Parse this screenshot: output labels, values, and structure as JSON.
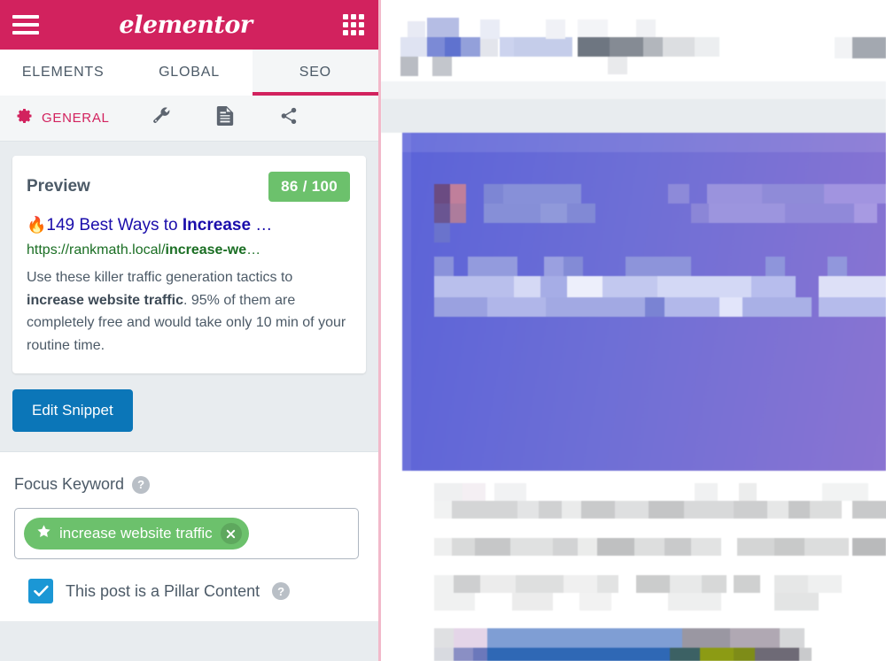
{
  "brand": {
    "name": "elementor",
    "menu_icon": "hamburger-icon",
    "apps_icon": "grid-icon"
  },
  "tabs": [
    {
      "label": "ELEMENTS",
      "active": false
    },
    {
      "label": "GLOBAL",
      "active": false
    },
    {
      "label": "SEO",
      "active": true
    }
  ],
  "subtabs": [
    {
      "label": "GENERAL",
      "icon": "gear-icon",
      "active": true
    },
    {
      "label": "",
      "icon": "wrench-icon",
      "active": false
    },
    {
      "label": "",
      "icon": "document-icon",
      "active": false
    },
    {
      "label": "",
      "icon": "share-icon",
      "active": false
    }
  ],
  "preview": {
    "heading": "Preview",
    "score": "86 / 100",
    "score_color": "#6cc16c",
    "snippet": {
      "emoji": "🔥",
      "title_plain": "149 Best Ways to ",
      "title_bold": "Increase",
      "title_ellipsis": " …",
      "url_base": "https://rankmath.local/",
      "url_slug": "increase-we",
      "url_ellipsis": "…",
      "desc_part1": "Use these killer traffic generation tactics to ",
      "desc_bold": "increase website traffic",
      "desc_part2": ". 95% of them are completely free and would take only 10 min of your routine time."
    }
  },
  "actions": {
    "edit_snippet": "Edit Snippet",
    "edit_snippet_color": "#0b76b8"
  },
  "focus_keyword": {
    "label": "Focus Keyword",
    "help": "?",
    "tag": "increase website traffic",
    "tag_icon": "star-icon",
    "remove_icon": "close-icon",
    "tag_color": "#6cc16c"
  },
  "pillar": {
    "label": "This post is a Pillar Content",
    "help": "?",
    "checked": true,
    "checkbox_color": "#1b97d5"
  },
  "theme": {
    "brand_crimson": "#d2225e",
    "panel_bg": "#e8ecef",
    "text": "#4c5a67",
    "link_blue": "#1a0dab",
    "url_green": "#1a6e23"
  }
}
